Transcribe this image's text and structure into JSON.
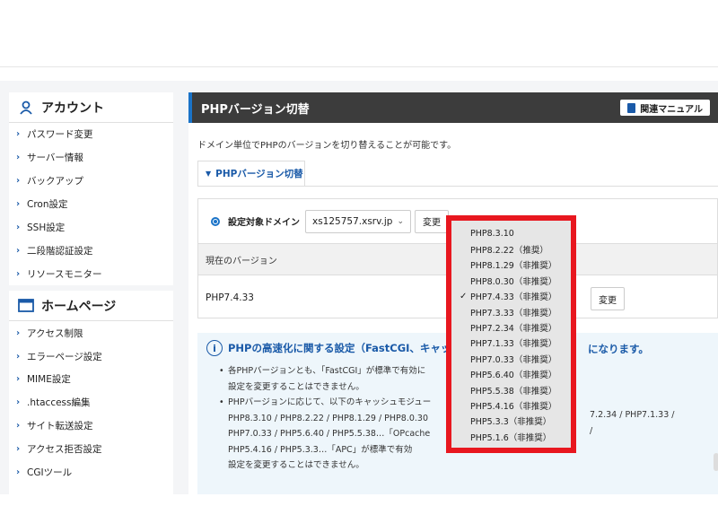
{
  "sidebar": {
    "account": {
      "title": "アカウント",
      "items": [
        "パスワード変更",
        "サーバー情報",
        "バックアップ",
        "Cron設定",
        "SSH設定",
        "二段階認証設定",
        "リソースモニター"
      ]
    },
    "homepage": {
      "title": "ホームページ",
      "items": [
        "アクセス制限",
        "エラーページ設定",
        "MIME設定",
        ".htaccess編集",
        "サイト転送設定",
        "アクセス拒否設定",
        "CGIツール"
      ]
    }
  },
  "main": {
    "title": "PHPバージョン切替",
    "manual_label": "関連マニュアル",
    "description": "ドメイン単位でPHPのバージョンを切り替えることが可能です。",
    "tab_label": "PHPバージョン切替",
    "domain_label": "設定対象ドメイン",
    "domain_value": "xs125757.xsrv.jp",
    "change_label": "変更",
    "current_header": "現在のバージョン",
    "current_value": "PHP7.4.33",
    "change_label_2": "変更"
  },
  "info": {
    "heading": "PHPの高速化に関する設定（FastCGI、キャッシ",
    "heading_tail": "になります。",
    "lines": [
      "各PHPバージョンとも、「FastCGI」が標準で有効に",
      "設定を変更することはできません。",
      "PHPバージョンに応じて、以下のキャッシュモジュー",
      "PHP8.3.10 / PHP8.2.22 / PHP8.1.29 / PHP8.0.30",
      "PHP7.0.33 / PHP5.6.40 / PHP5.5.38…「OPcache",
      "PHP5.4.16 / PHP5.3.3…「APC」が標準で有効",
      "設定を変更することはできません。"
    ],
    "right_1": "7.2.34 / PHP7.1.33 /",
    "right_2": "/"
  },
  "dropdown": {
    "selected": "PHP7.4.33（非推奨）",
    "options": [
      "PHP8.3.10",
      "PHP8.2.22（推奨）",
      "PHP8.1.29（非推奨）",
      "PHP8.0.30（非推奨）",
      "PHP7.4.33（非推奨）",
      "PHP7.3.33（非推奨）",
      "PHP7.2.34（非推奨）",
      "PHP7.1.33（非推奨）",
      "PHP7.0.33（非推奨）",
      "PHP5.6.40（非推奨）",
      "PHP5.5.38（非推奨）",
      "PHP5.4.16（非推奨）",
      "PHP5.3.3（非推奨）",
      "PHP5.1.6（非推奨）"
    ],
    "selected_index": 4
  },
  "colors": {
    "accent_blue": "#1a5aa8",
    "title_bar": "#3c3c3c",
    "highlight_red": "#e8171f",
    "info_bg": "#eef6fb"
  }
}
